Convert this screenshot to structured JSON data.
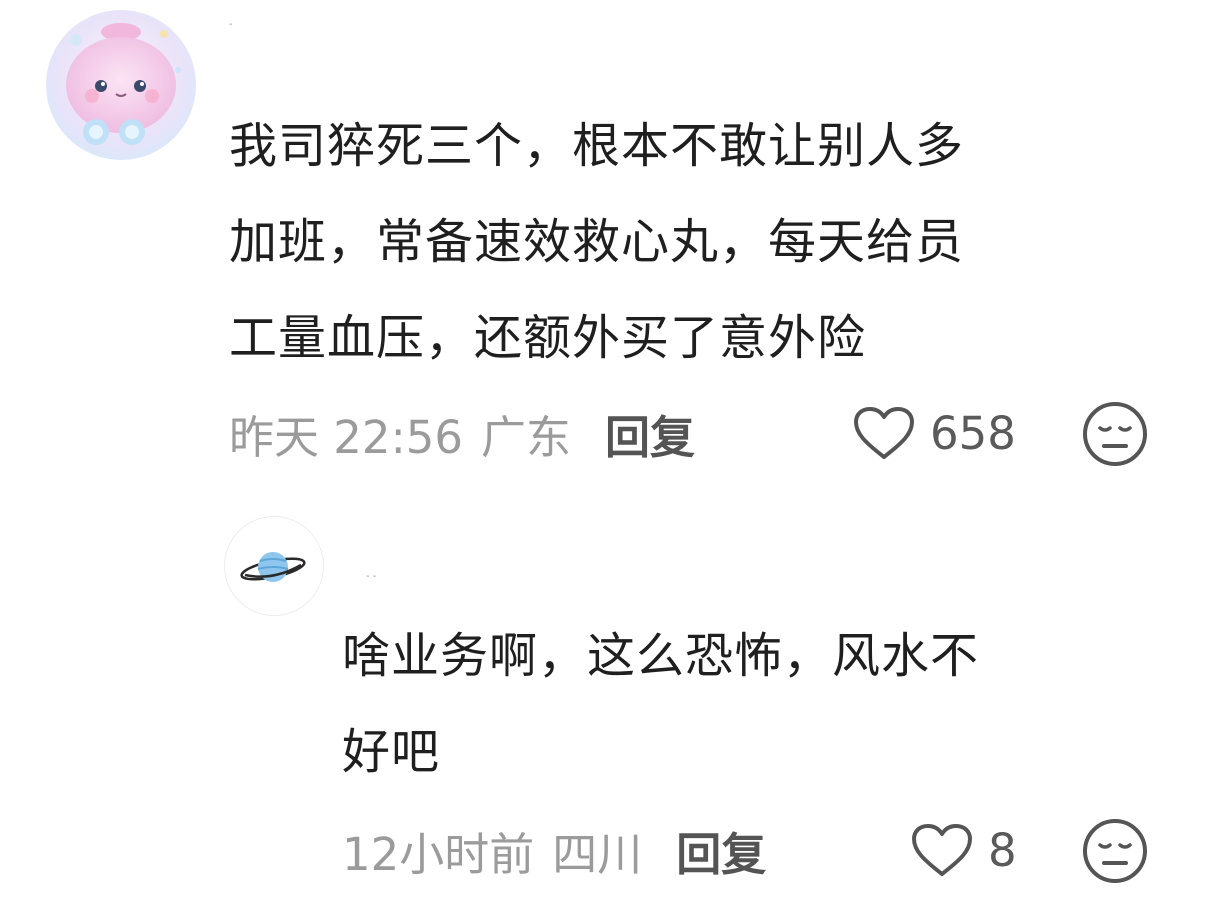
{
  "comments": [
    {
      "username": "-",
      "text_lines": [
        "我司猝死三个，根本不敢让别人多",
        "加班，常备速效救心丸，每天给员",
        "工量血压，还额外买了意外险"
      ],
      "time": "昨天 22:56",
      "location": "广东",
      "reply_label": "回复",
      "like_count": "658",
      "avatar_icon": "pink-blob-avatar-icon"
    },
    {
      "username": "- -",
      "text_lines": [
        "啥业务啊，这么恐怖，风水不",
        "好吧"
      ],
      "time": "12小时前",
      "location": "四川",
      "reply_label": "回复",
      "like_count": "8",
      "avatar_icon": "planet-avatar-icon"
    }
  ],
  "colors": {
    "text": "#1f1f1f",
    "meta": "#9b9b9b",
    "reply": "#545454",
    "icon": "#555555"
  }
}
